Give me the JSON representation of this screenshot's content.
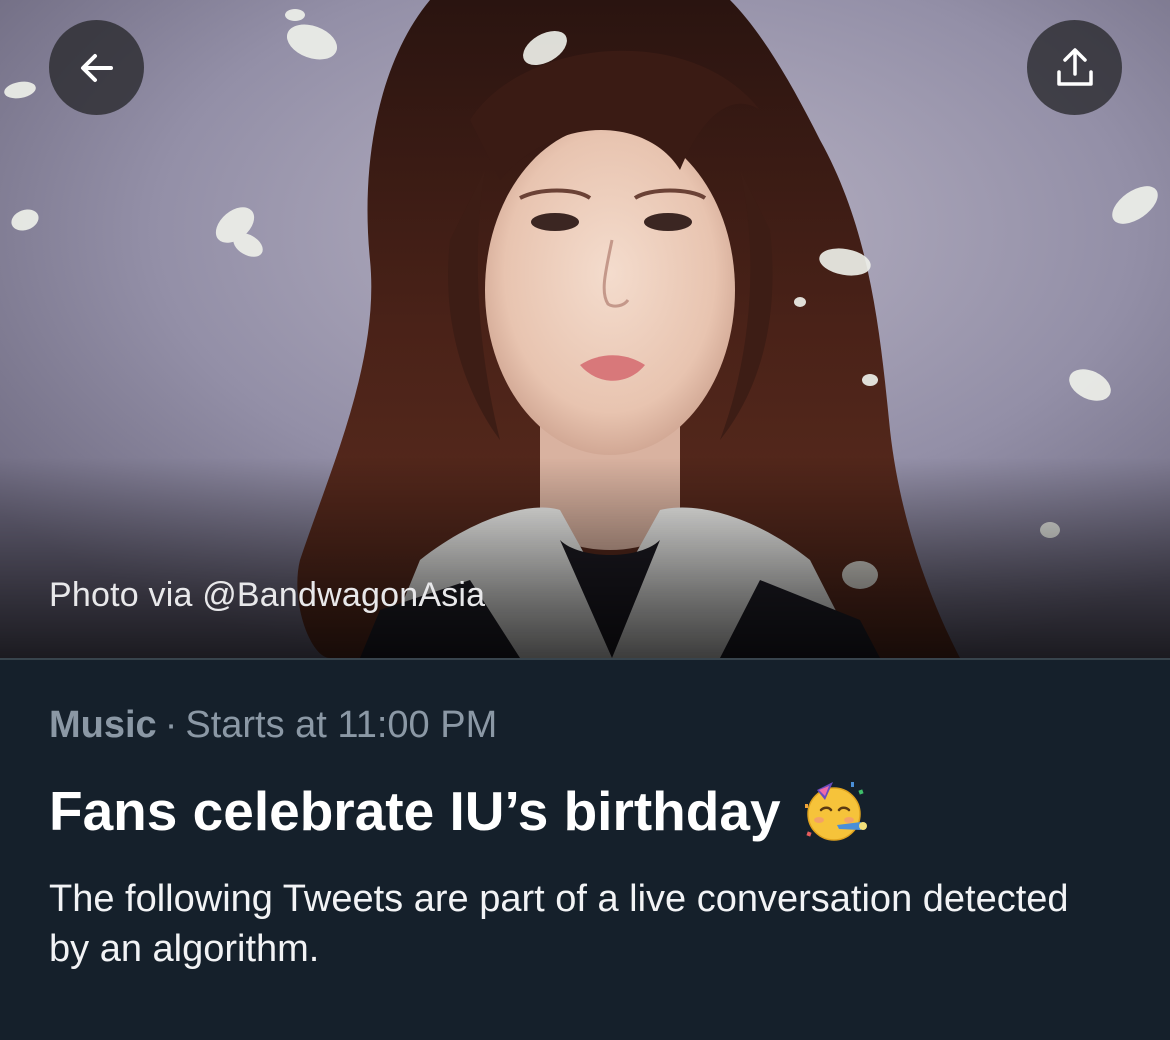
{
  "header": {
    "back_icon": "arrow-left-icon",
    "share_icon": "share-upload-icon",
    "photo_credit": "Photo via @BandwagonAsia"
  },
  "event": {
    "category": "Music",
    "separator": "·",
    "start_time": "Starts at 11:00 PM",
    "title": "Fans celebrate IU’s birthday",
    "title_emoji": "partying-face-icon",
    "description": "The following Tweets are part of a live conversation detected by an algorithm."
  },
  "colors": {
    "background": "#15202b",
    "muted_text": "#8b98a5",
    "primary_text": "#ffffff"
  }
}
